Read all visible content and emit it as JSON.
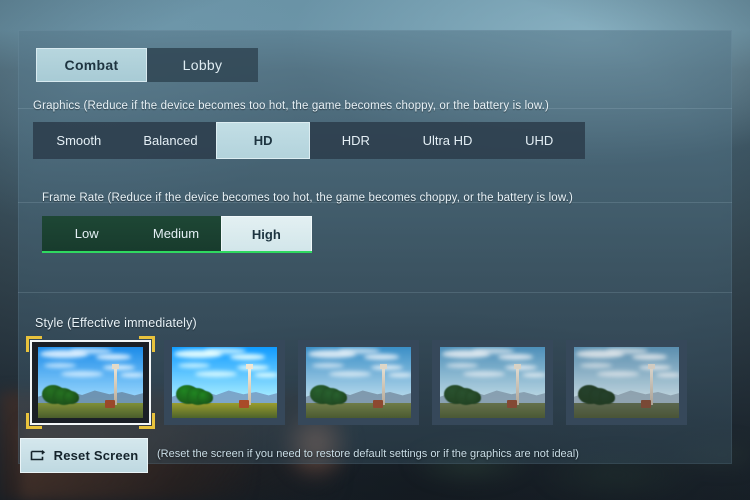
{
  "tabs": [
    {
      "label": "Combat",
      "selected": true
    },
    {
      "label": "Lobby",
      "selected": false
    }
  ],
  "graphics": {
    "label": "Graphics (Reduce if the device becomes too hot, the game becomes choppy, or the battery is low.)",
    "options": [
      {
        "label": "Smooth",
        "selected": false
      },
      {
        "label": "Balanced",
        "selected": false
      },
      {
        "label": "HD",
        "selected": true
      },
      {
        "label": "HDR",
        "selected": false
      },
      {
        "label": "Ultra HD",
        "selected": false
      },
      {
        "label": "UHD",
        "selected": false
      }
    ]
  },
  "frame_rate": {
    "label": "Frame Rate (Reduce if the device becomes too hot, the game becomes choppy, or the battery is low.)",
    "options": [
      {
        "label": "Low",
        "selected": false
      },
      {
        "label": "Medium",
        "selected": false
      },
      {
        "label": "High",
        "selected": true
      }
    ]
  },
  "style": {
    "label": "Style (Effective immediately)",
    "thumbnails": [
      {
        "name": "style-1",
        "selected": true,
        "sky_top": "#2e86cf",
        "sky_bottom": "#9fd0ee",
        "ground": "#7d8a46",
        "tree": "#2f6b2c",
        "mountain": "#6f8ba2",
        "saturation": 1.25,
        "brightness": 1.02
      },
      {
        "name": "style-2",
        "selected": false,
        "sky_top": "#2b8ad8",
        "sky_bottom": "#a8d8f2",
        "ground": "#8d8f43",
        "tree": "#2f7430",
        "mountain": "#7792ab",
        "saturation": 1.35,
        "brightness": 1.08
      },
      {
        "name": "style-3",
        "selected": false,
        "sky_top": "#3e8ec4",
        "sky_bottom": "#b7d9ea",
        "ground": "#6f7c4a",
        "tree": "#2a5f30",
        "mountain": "#7d95a8",
        "saturation": 1.05,
        "brightness": 1.0
      },
      {
        "name": "style-4",
        "selected": false,
        "sky_top": "#4a93c2",
        "sky_bottom": "#bcdce9",
        "ground": "#66744a",
        "tree": "#27542d",
        "mountain": "#85a0b2",
        "saturation": 0.92,
        "brightness": 0.98
      },
      {
        "name": "style-5",
        "selected": false,
        "sky_top": "#5498c4",
        "sky_bottom": "#c3e0ec",
        "ground": "#5e6c4c",
        "tree": "#22462a",
        "mountain": "#8ea7b8",
        "saturation": 0.8,
        "brightness": 0.95
      }
    ]
  },
  "reset": {
    "button_label": "Reset Screen",
    "icon": "reset-screen-icon",
    "hint": "(Reset the screen if you need to restore default settings or if the graphics are not ideal)"
  },
  "colors": {
    "accent_selected": "#b7d6de",
    "frame_rate_green": "#2fd860",
    "selection_gold": "#e8c23c",
    "panel_background": "#4a6a7c",
    "text_primary": "#e8f2f7"
  }
}
